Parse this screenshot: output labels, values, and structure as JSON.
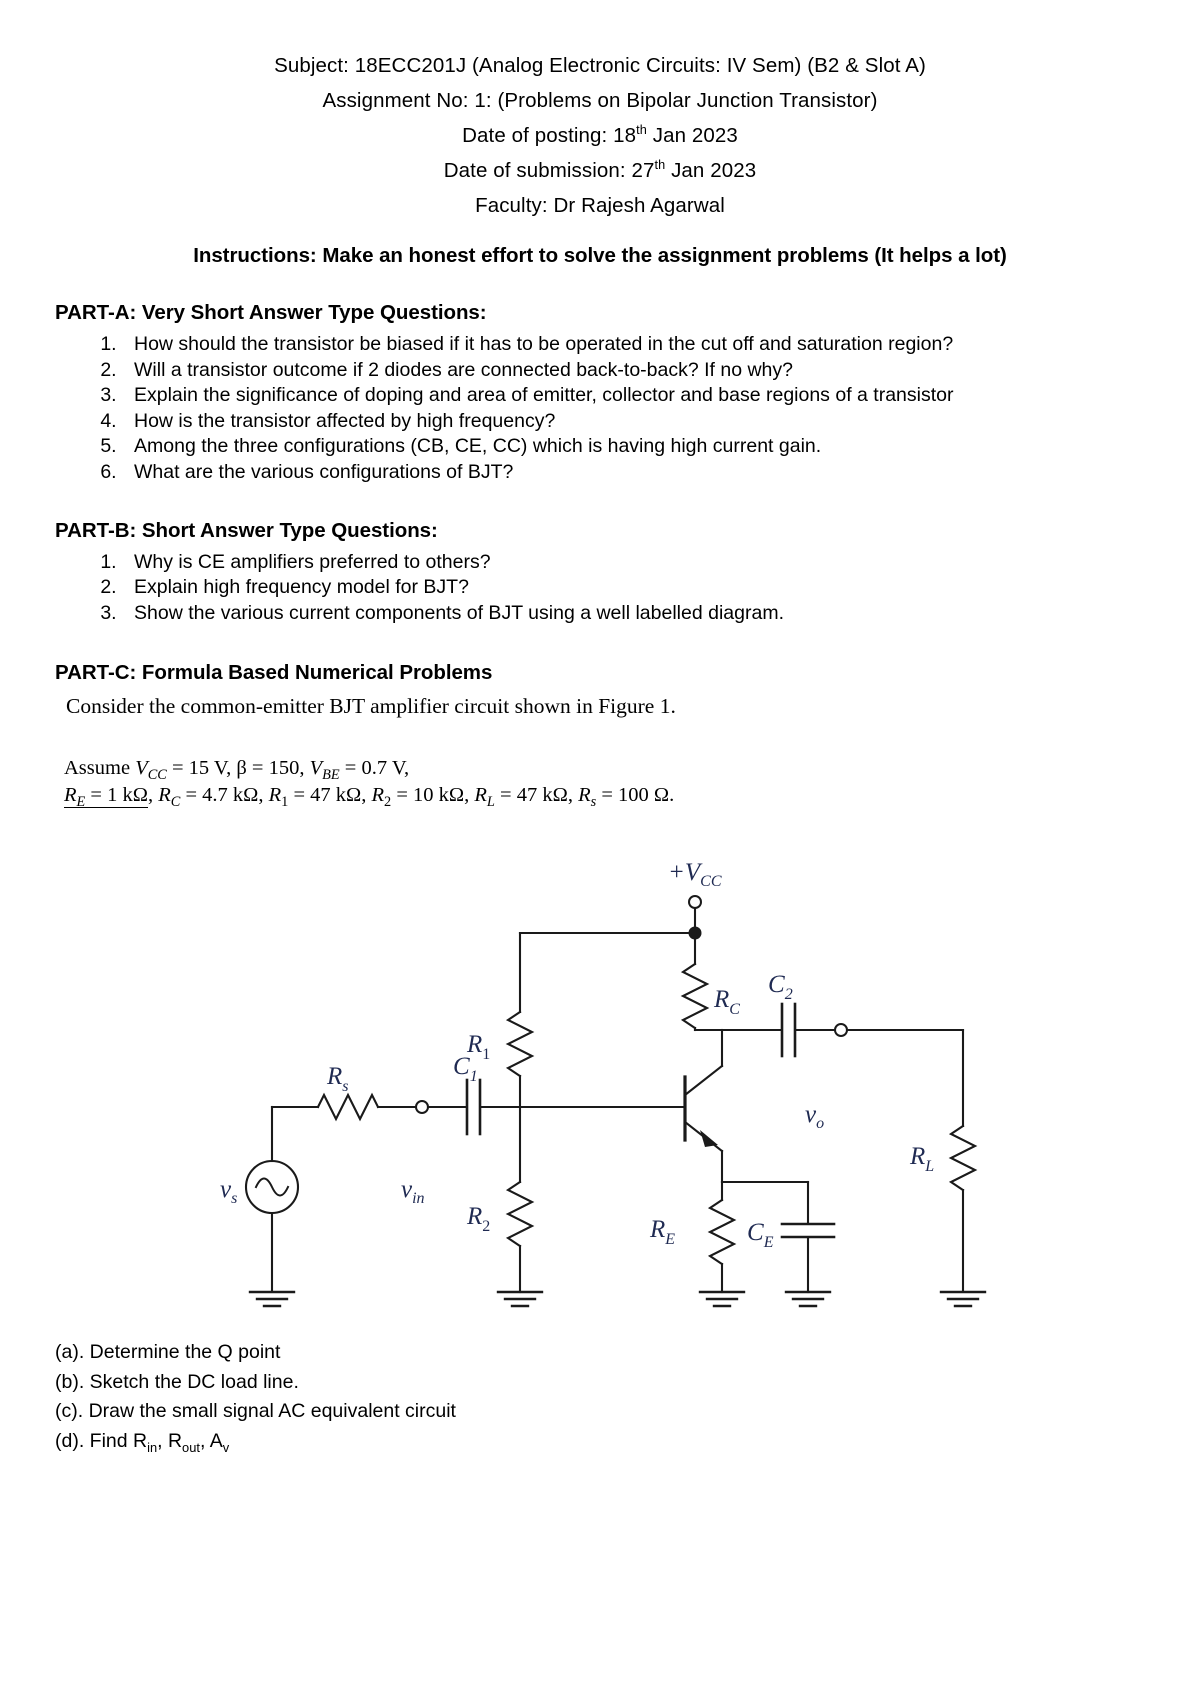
{
  "header": {
    "lines": [
      "Subject: 18ECC201J (Analog Electronic Circuits: IV Sem) (B2 & Slot A)",
      "Assignment No: 1: (Problems on Bipolar Junction Transistor)"
    ],
    "posting_label": "Date of posting: 18",
    "posting_sup": "th",
    "posting_rest": " Jan 2023",
    "submission_label": "Date of submission: 27",
    "submission_sup": "th",
    "submission_rest": " Jan 2023",
    "faculty": "Faculty: Dr Rajesh Agarwal",
    "instructions": "Instructions: Make an honest effort to solve the assignment problems (It helps a lot)"
  },
  "part_a": {
    "heading": "PART-A: Very Short Answer Type Questions:",
    "questions": [
      "How should the transistor be biased if it has to be operated in the cut off and saturation region?",
      "Will a transistor outcome if 2 diodes are connected back-to-back? If no why?",
      "Explain the significance of doping and area of emitter, collector and base regions of a transistor",
      "How is the transistor affected by high frequency?",
      "Among the three configurations (CB, CE, CC) which is having high current gain.",
      "What are the various configurations of BJT?"
    ]
  },
  "part_b": {
    "heading": "PART-B: Short Answer Type Questions:",
    "questions": [
      "Why is CE amplifiers preferred to others?",
      "Explain high frequency model for BJT?",
      "Show the various current components of BJT using a well labelled diagram."
    ]
  },
  "part_c": {
    "heading": "PART-C: Formula Based Numerical Problems",
    "consider": "Consider the common-emitter BJT amplifier circuit shown in Figure 1.",
    "assume_prefix": "Assume ",
    "assume_line1": {
      "vcc_sym": "V",
      "vcc_sub": "CC",
      "vcc_val": " = 15 V, ",
      "beta": "β = 150, ",
      "vbe_sym": "V",
      "vbe_sub": "BE",
      "vbe_val": " = 0.7 V,"
    },
    "assume_line2": {
      "re_sym": "R",
      "re_sub": "E",
      "re_val": " = 1 kΩ",
      "rc_sym": "R",
      "rc_sub": "C",
      "rc_val": " = 4.7 kΩ",
      "r1_sym": "R",
      "r1_sub": "1",
      "r1_val": " = 47 kΩ",
      "r2_sym": "R",
      "r2_sub": "2",
      "r2_val": " = 10 kΩ",
      "rl_sym": "R",
      "rl_sub": "L",
      "rl_val": " = 47 kΩ",
      "rs_sym": "R",
      "rs_sub": "s",
      "rs_val": " = 100 Ω."
    }
  },
  "figure": {
    "labels": {
      "vcc": "+V",
      "vcc_sub": "CC",
      "r1": "R",
      "r1_sub": "1",
      "r2": "R",
      "r2_sub": "2",
      "rc": "R",
      "rc_sub": "C",
      "re": "R",
      "re_sub": "E",
      "rl": "R",
      "rl_sub": "L",
      "rs": "R",
      "rs_sub": "s",
      "c1": "C",
      "c1_sub": "1",
      "c2": "C",
      "c2_sub": "2",
      "ce": "C",
      "ce_sub": "E",
      "vs": "v",
      "vs_sub": "s",
      "vin": "v",
      "vin_sub": "in",
      "vo": "v",
      "vo_sub": "o"
    },
    "label_color": "#1f2a52",
    "wire_color": "#1a1a1a"
  },
  "sub_questions": {
    "a_text": "(a). Determine the Q point",
    "b_text": "(b). Sketch the DC load line.",
    "c_text": "(c). Draw the small signal AC equivalent circuit",
    "d_prefix": "(d). Find R",
    "d_sub1": "in",
    "d_mid1": ", R",
    "d_sub2": "out",
    "d_mid2": ", A",
    "d_sub3": "v"
  }
}
